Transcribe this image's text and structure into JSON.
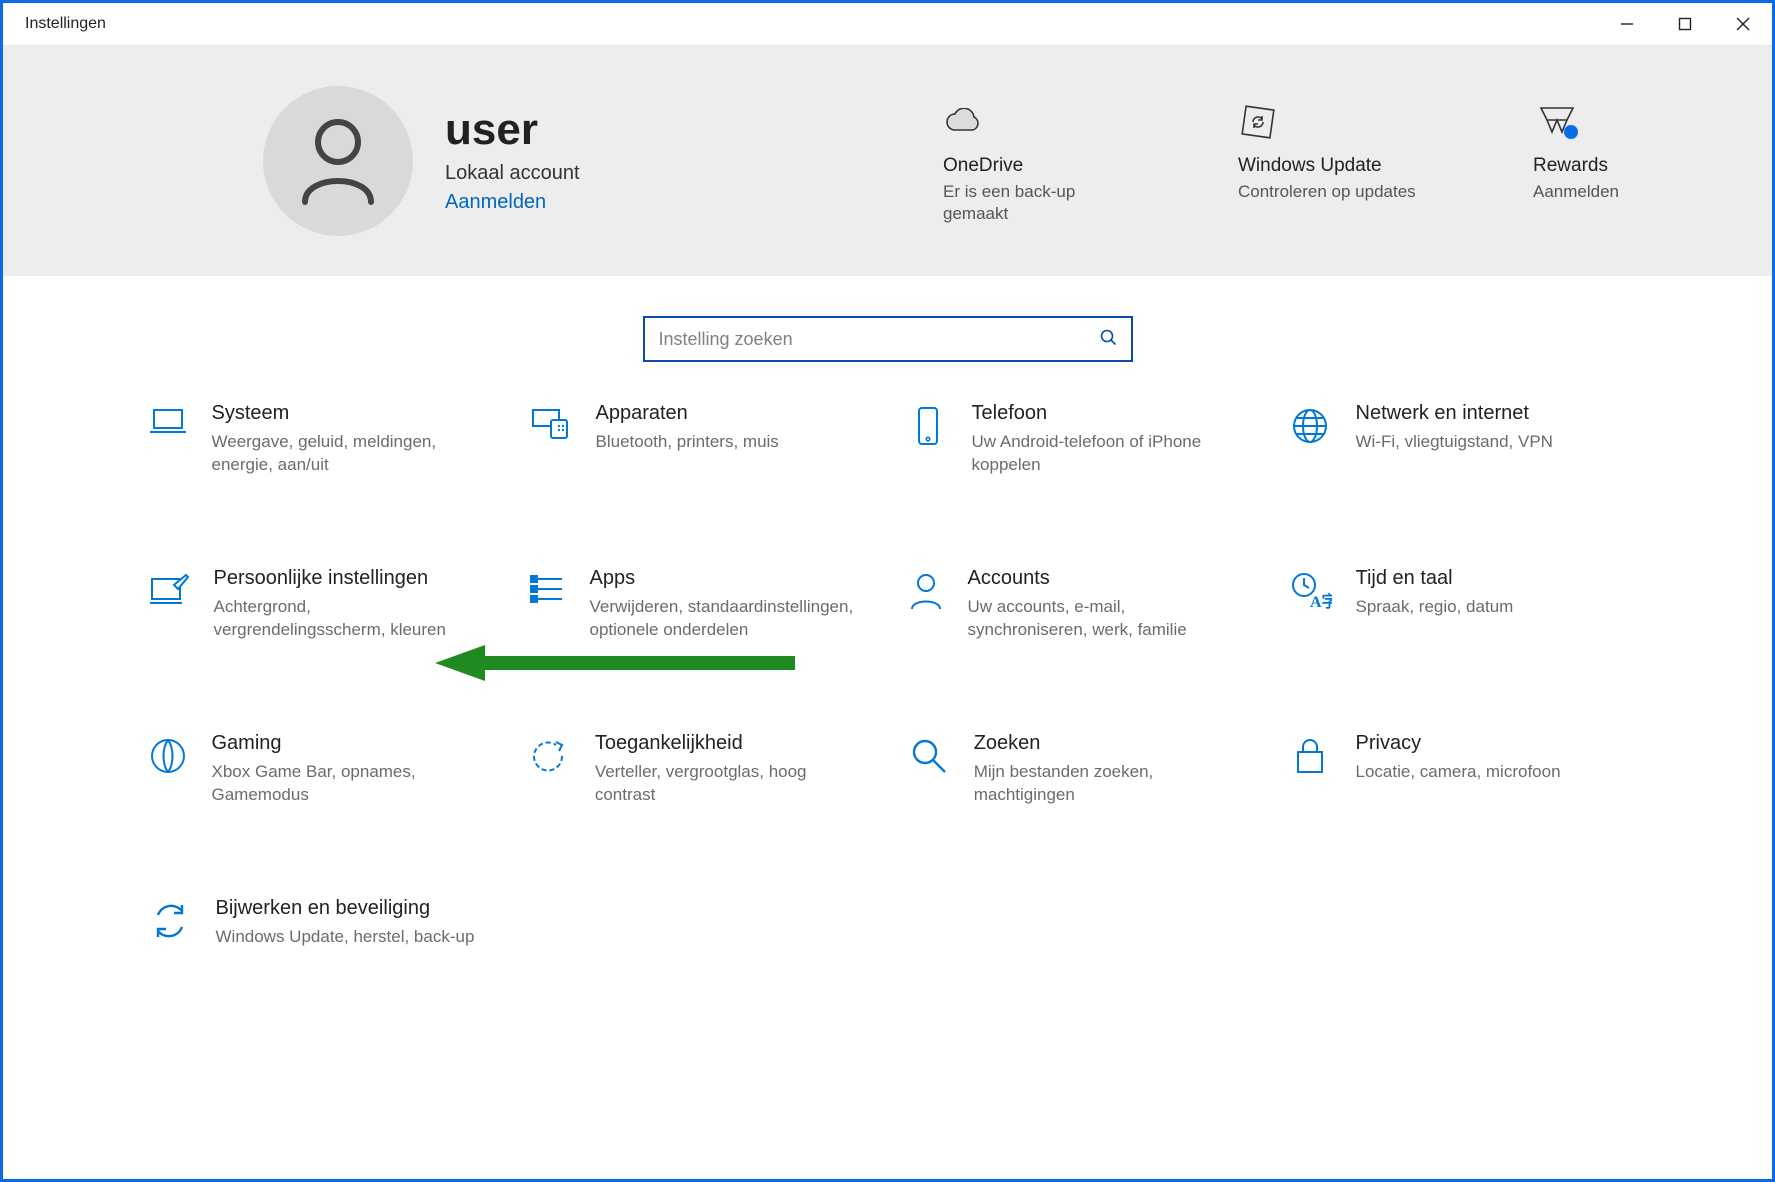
{
  "window": {
    "title": "Instellingen"
  },
  "user": {
    "name": "user",
    "account_type": "Lokaal account",
    "signin_link": "Aanmelden"
  },
  "tiles": [
    {
      "label": "OneDrive",
      "sub": "Er is een back-up gemaakt"
    },
    {
      "label": "Windows Update",
      "sub": "Controleren op updates"
    },
    {
      "label": "Rewards",
      "sub": "Aanmelden"
    }
  ],
  "search": {
    "placeholder": "Instelling zoeken"
  },
  "categories": [
    {
      "title": "Systeem",
      "sub": "Weergave, geluid, meldingen, energie, aan/uit"
    },
    {
      "title": "Apparaten",
      "sub": "Bluetooth, printers, muis"
    },
    {
      "title": "Telefoon",
      "sub": "Uw Android-telefoon of iPhone koppelen"
    },
    {
      "title": "Netwerk en internet",
      "sub": "Wi-Fi, vliegtuigstand, VPN"
    },
    {
      "title": "Persoonlijke instellingen",
      "sub": "Achtergrond, vergrendelingsscherm, kleuren"
    },
    {
      "title": "Apps",
      "sub": "Verwijderen, standaardinstellingen, optionele onderdelen"
    },
    {
      "title": "Accounts",
      "sub": "Uw accounts, e-mail, synchroniseren, werk, familie"
    },
    {
      "title": "Tijd en taal",
      "sub": "Spraak, regio, datum"
    },
    {
      "title": "Gaming",
      "sub": "Xbox Game Bar, opnames, Gamemodus"
    },
    {
      "title": "Toegankelijkheid",
      "sub": "Verteller, vergrootglas, hoog contrast"
    },
    {
      "title": "Zoeken",
      "sub": "Mijn bestanden zoeken, machtigingen"
    },
    {
      "title": "Privacy",
      "sub": "Locatie, camera, microfoon"
    },
    {
      "title": "Bijwerken en beveiliging",
      "sub": "Windows Update, herstel, back-up"
    }
  ],
  "colors": {
    "accent": "#0078d4",
    "border": "#0a6be8",
    "arrow": "#1f8a1f"
  }
}
